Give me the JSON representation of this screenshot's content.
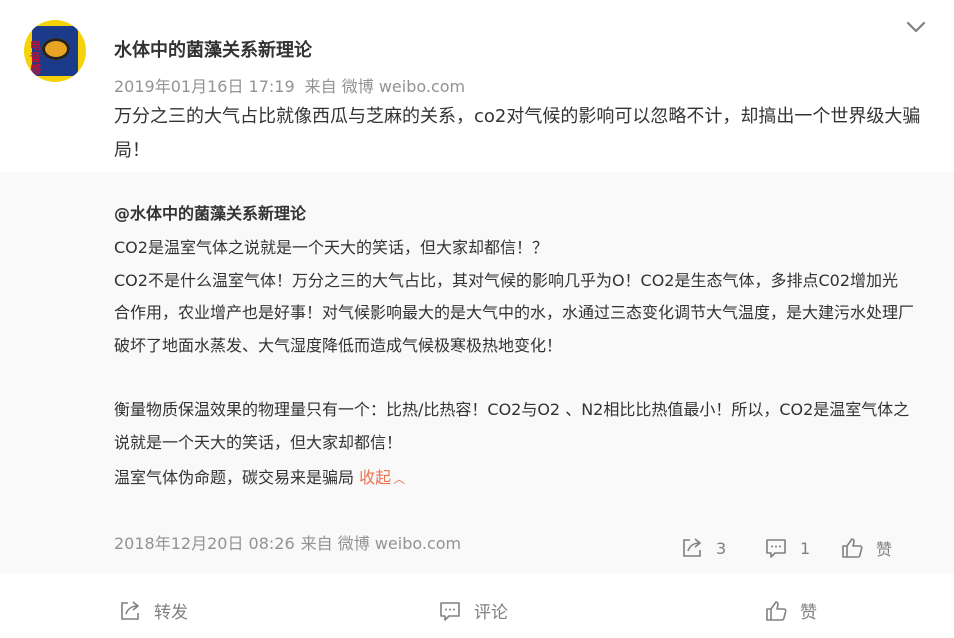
{
  "post": {
    "author": "水体中的菌藻关系新理论",
    "avatar_text": "电音感",
    "date": "2019年01月16日 17:19",
    "source": "来自 微博 weibo.com",
    "text": "万分之三的大气占比就像西瓜与芝麻的关系，co2对气候的影响可以忽略不计，却搞出一个世界级大骗局！"
  },
  "repost": {
    "author": "@水体中的菌藻关系新理论",
    "lines": [
      "CO2是温室气体之说就是一个天大的笑话，但大家却都信！？",
      "CO2不是什么温室气体！万分之三的大气占比，其对气候的影响几乎为O！CO2是生态气体，多排点C02增加光合作用，农业增产也是好事！对气候影响最大的是大气中的水，水通过三态变化调节大气温度，是大建污水处理厂破坏了地面水蒸发、大气湿度降低而造成气候极寒极热地变化！",
      "衡量物质保温效果的物理量只有一个：比热/比热容！CO2与O2 、N2相比比热值最小！所以，CO2是温室气体之说就是一个天大的笑话，但大家却都信！",
      "温室气体伪命题，碳交易来是骗局"
    ],
    "collapse_label": "收起",
    "date": "2018年12月20日 08:26",
    "source": "来自 微博 weibo.com",
    "share_count": "3",
    "comment_count": "1",
    "like_label": "赞"
  },
  "actions": {
    "forward": "转发",
    "comment": "评论",
    "like": "赞"
  },
  "icons": {
    "expand": "chevron-down-icon",
    "share": "share-icon",
    "comment": "comment-icon",
    "like": "thumbs-up-icon"
  },
  "colors": {
    "accent": "#eb7350",
    "meta": "#939393",
    "icon": "#808080",
    "repost_bg": "#f9f9f9"
  }
}
